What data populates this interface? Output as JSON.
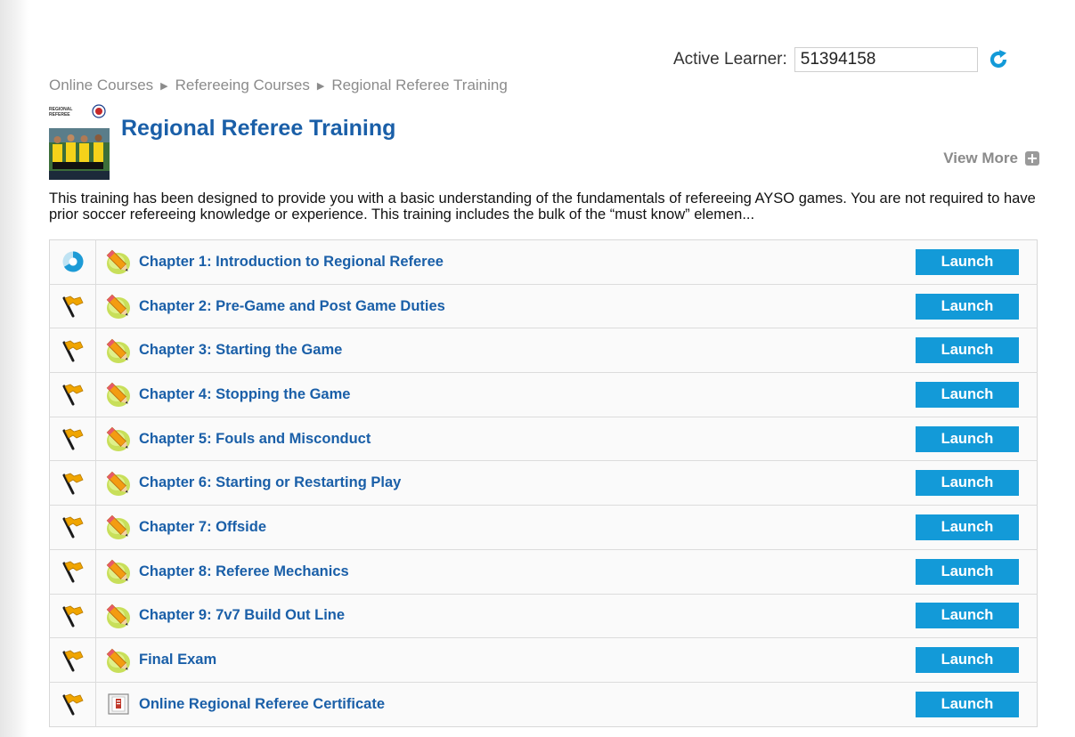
{
  "header": {
    "active_learner_label": "Active Learner:",
    "active_learner_value": "51394158",
    "refresh_icon": "refresh-icon"
  },
  "breadcrumb": [
    "Online Courses",
    "Refereeing Courses",
    "Regional Referee Training"
  ],
  "course": {
    "title": "Regional Referee Training",
    "view_more_label": "View More",
    "description": "This training has been designed to provide you with a basic understanding of the fundamentals of refereeing AYSO games. You are not required to have prior soccer refereeing knowledge or experience. This training includes the bulk of the “must know” elemen...",
    "thumb_text": [
      "REGIONAL",
      "REFEREE"
    ]
  },
  "chapters": [
    {
      "status_icon": "in-progress-icon",
      "type_icon": "pencil-icon",
      "title": "Chapter 1: Introduction to Regional Referee",
      "action": "Launch"
    },
    {
      "status_icon": "flag-icon",
      "type_icon": "pencil-icon",
      "title": "Chapter 2: Pre-Game and Post Game Duties",
      "action": "Launch"
    },
    {
      "status_icon": "flag-icon",
      "type_icon": "pencil-icon",
      "title": "Chapter 3: Starting the Game",
      "action": "Launch"
    },
    {
      "status_icon": "flag-icon",
      "type_icon": "pencil-icon",
      "title": "Chapter 4: Stopping the Game",
      "action": "Launch"
    },
    {
      "status_icon": "flag-icon",
      "type_icon": "pencil-icon",
      "title": "Chapter 5: Fouls and Misconduct",
      "action": "Launch"
    },
    {
      "status_icon": "flag-icon",
      "type_icon": "pencil-icon",
      "title": "Chapter 6: Starting or Restarting Play",
      "action": "Launch"
    },
    {
      "status_icon": "flag-icon",
      "type_icon": "pencil-icon",
      "title": "Chapter 7: Offside",
      "action": "Launch"
    },
    {
      "status_icon": "flag-icon",
      "type_icon": "pencil-icon",
      "title": "Chapter 8: Referee Mechanics",
      "action": "Launch"
    },
    {
      "status_icon": "flag-icon",
      "type_icon": "pencil-icon",
      "title": "Chapter 9: 7v7 Build Out Line",
      "action": "Launch"
    },
    {
      "status_icon": "flag-icon",
      "type_icon": "pencil-icon",
      "title": "Final Exam",
      "action": "Launch"
    },
    {
      "status_icon": "flag-icon",
      "type_icon": "certificate-icon",
      "title": "Online Regional Referee Certificate",
      "action": "Launch"
    }
  ],
  "colors": {
    "accent": "#139ad8",
    "link": "#1a5fa8",
    "flag": "#f0a500"
  }
}
